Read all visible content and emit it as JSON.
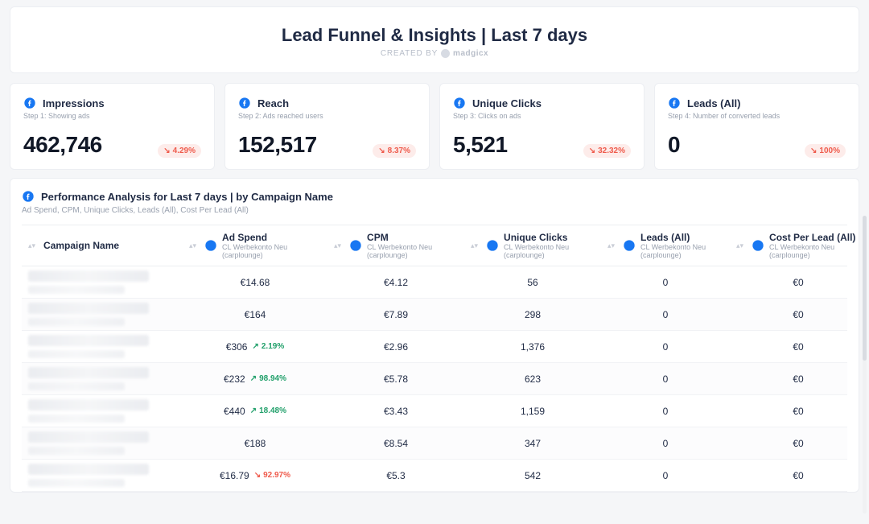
{
  "header": {
    "title": "Lead Funnel & Insights | Last 7 days",
    "created_by_label": "CREATED BY",
    "brand": "madgicx"
  },
  "kpis": [
    {
      "title": "Impressions",
      "step": "Step 1: Showing ads",
      "value": "462,746",
      "delta": "4.29%",
      "dir": "dn"
    },
    {
      "title": "Reach",
      "step": "Step 2: Ads reached users",
      "value": "152,517",
      "delta": "8.37%",
      "dir": "dn"
    },
    {
      "title": "Unique Clicks",
      "step": "Step 3: Clicks on ads",
      "value": "5,521",
      "delta": "32.32%",
      "dir": "dn"
    },
    {
      "title": "Leads (All)",
      "step": "Step 4: Number of converted leads",
      "value": "0",
      "delta": "100%",
      "dir": "dn"
    }
  ],
  "panel": {
    "title": "Performance Analysis for Last 7 days | by Campaign Name",
    "subtitle": "Ad Spend, CPM, Unique Clicks, Leads (All), Cost Per Lead (All)"
  },
  "columns": {
    "account_sub": "CL Werbekonto Neu (carplounge)",
    "c0": "Campaign Name",
    "c1": "Ad Spend",
    "c2": "CPM",
    "c3": "Unique Clicks",
    "c4": "Leads (All)",
    "c5": "Cost Per Lead (All)"
  },
  "rows": [
    {
      "spend": "€14.68",
      "spend_delta": "",
      "spend_dir": "",
      "cpm": "€4.12",
      "clicks": "56",
      "leads": "0",
      "cpl": "€0"
    },
    {
      "spend": "€164",
      "spend_delta": "",
      "spend_dir": "",
      "cpm": "€7.89",
      "clicks": "298",
      "leads": "0",
      "cpl": "€0"
    },
    {
      "spend": "€306",
      "spend_delta": "2.19%",
      "spend_dir": "up",
      "cpm": "€2.96",
      "clicks": "1,376",
      "leads": "0",
      "cpl": "€0"
    },
    {
      "spend": "€232",
      "spend_delta": "98.94%",
      "spend_dir": "up",
      "cpm": "€5.78",
      "clicks": "623",
      "leads": "0",
      "cpl": "€0"
    },
    {
      "spend": "€440",
      "spend_delta": "18.48%",
      "spend_dir": "up",
      "cpm": "€3.43",
      "clicks": "1,159",
      "leads": "0",
      "cpl": "€0"
    },
    {
      "spend": "€188",
      "spend_delta": "",
      "spend_dir": "",
      "cpm": "€8.54",
      "clicks": "347",
      "leads": "0",
      "cpl": "€0"
    },
    {
      "spend": "€16.79",
      "spend_delta": "92.97%",
      "spend_dir": "dn",
      "cpm": "€5.3",
      "clicks": "542",
      "leads": "0",
      "cpl": "€0"
    }
  ]
}
